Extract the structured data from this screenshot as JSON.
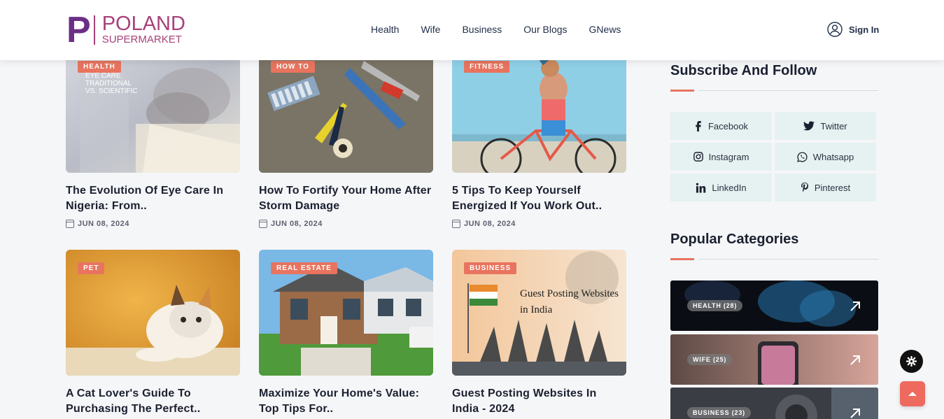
{
  "brand": {
    "letter": "P",
    "line1": "POLAND",
    "line2": "SUPERMARKET"
  },
  "nav": [
    "Health",
    "Wife",
    "Business",
    "Our Blogs",
    "GNews"
  ],
  "signin_label": "Sign In",
  "cards": [
    {
      "badge": "HEALTH",
      "title": "The Evolution Of Eye Care In Nigeria: From..",
      "date": "JUN 08, 2024",
      "overlay_text": [
        "EYE CARE:",
        "TRADITIONAL",
        "VS. SCIENTIFIC"
      ]
    },
    {
      "badge": "HOW TO",
      "title": "How To Fortify Your Home After Storm Damage",
      "date": "JUN 08, 2024"
    },
    {
      "badge": "FITNESS",
      "title": "5 Tips To Keep Yourself Energized If You Work Out..",
      "date": "JUN 08, 2024"
    },
    {
      "badge": "PET",
      "title": "A Cat Lover's Guide To Purchasing The Perfect..",
      "date": ""
    },
    {
      "badge": "REAL ESTATE",
      "title": "Maximize Your Home's Value: Top Tips For..",
      "date": ""
    },
    {
      "badge": "BUSINESS",
      "title": "Guest Posting Websites In India - 2024",
      "date": "",
      "overlay_text": [
        "Guest Posting Websites",
        "in India"
      ]
    }
  ],
  "subscribe": {
    "title": "Subscribe And Follow",
    "buttons": [
      {
        "label": "Facebook",
        "icon": "facebook-icon"
      },
      {
        "label": "Twitter",
        "icon": "twitter-icon"
      },
      {
        "label": "Instagram",
        "icon": "instagram-icon"
      },
      {
        "label": "Whatsapp",
        "icon": "whatsapp-icon"
      },
      {
        "label": "LinkedIn",
        "icon": "linkedin-icon"
      },
      {
        "label": "Pinterest",
        "icon": "pinterest-icon"
      }
    ]
  },
  "categories": {
    "title": "Popular Categories",
    "items": [
      {
        "label": "HEALTH (28)"
      },
      {
        "label": "WIFE (25)"
      },
      {
        "label": "BUSINESS (23)"
      }
    ]
  },
  "colors": {
    "accent": "#e8745f",
    "brand": "#6b2f86",
    "brand_pink": "#a8417a",
    "social_bg": "#e6f1f1"
  }
}
